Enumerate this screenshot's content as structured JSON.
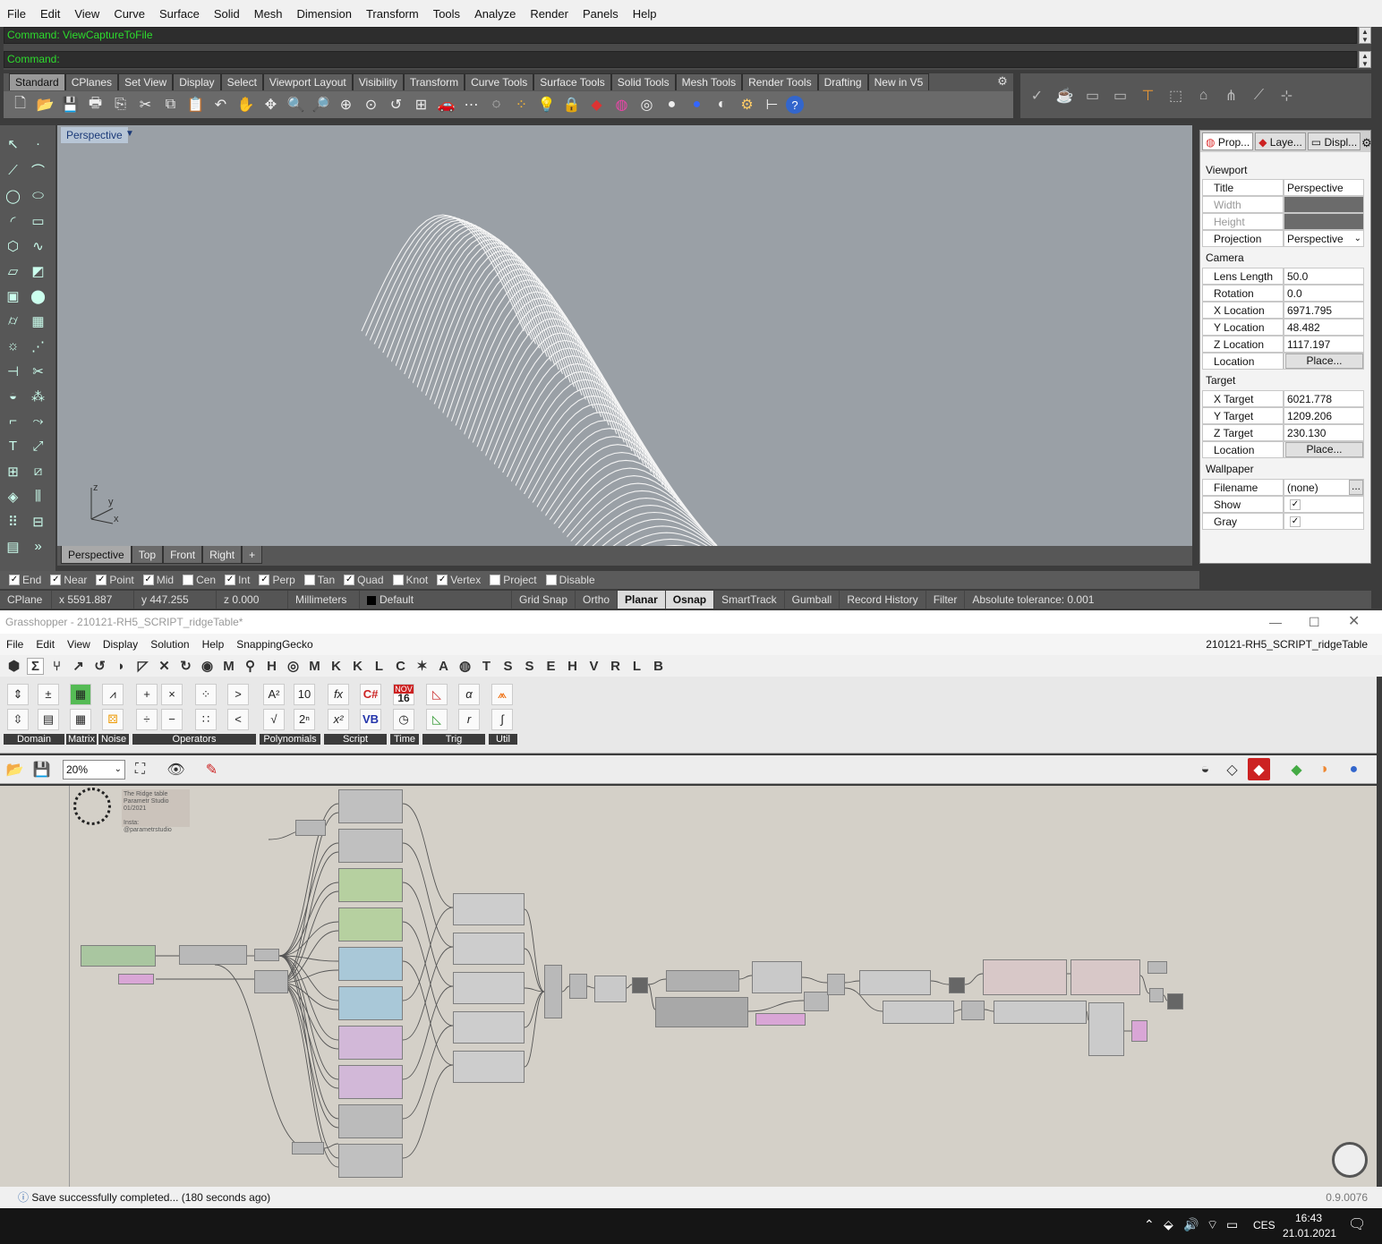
{
  "rhino": {
    "menu": [
      "File",
      "Edit",
      "View",
      "Curve",
      "Surface",
      "Solid",
      "Mesh",
      "Dimension",
      "Transform",
      "Tools",
      "Analyze",
      "Render",
      "Panels",
      "Help"
    ],
    "command_history": "Command: ViewCaptureToFile",
    "command_prompt": "Command:",
    "toolbar_tabs": [
      "Standard",
      "CPlanes",
      "Set View",
      "Display",
      "Select",
      "Viewport Layout",
      "Visibility",
      "Transform",
      "Curve Tools",
      "Surface Tools",
      "Solid Tools",
      "Mesh Tools",
      "Render Tools",
      "Drafting",
      "New in V5"
    ],
    "viewport_title": "Perspective",
    "viewport_tabs": [
      "Perspective",
      "Top",
      "Front",
      "Right"
    ],
    "axis_labels": {
      "z": "z",
      "y": "y",
      "x": "x"
    },
    "osnaps": [
      {
        "label": "End",
        "checked": true
      },
      {
        "label": "Near",
        "checked": true
      },
      {
        "label": "Point",
        "checked": true
      },
      {
        "label": "Mid",
        "checked": true
      },
      {
        "label": "Cen",
        "checked": false
      },
      {
        "label": "Int",
        "checked": true
      },
      {
        "label": "Perp",
        "checked": true
      },
      {
        "label": "Tan",
        "checked": false
      },
      {
        "label": "Quad",
        "checked": true
      },
      {
        "label": "Knot",
        "checked": false
      },
      {
        "label": "Vertex",
        "checked": true
      },
      {
        "label": "Project",
        "checked": false
      },
      {
        "label": "Disable",
        "checked": false
      }
    ],
    "status": {
      "cplane": "CPlane",
      "x": "x 5591.887",
      "y": "y 447.255",
      "z": "z 0.000",
      "units": "Millimeters",
      "layer": "Default",
      "grid_snap": "Grid Snap",
      "ortho": "Ortho",
      "planar": "Planar",
      "osnap": "Osnap",
      "smarttrack": "SmartTrack",
      "gumball": "Gumball",
      "record_history": "Record History",
      "filter": "Filter",
      "tolerance": "Absolute tolerance: 0.001"
    },
    "properties": {
      "tabs": [
        "Prop...",
        "Laye...",
        "Displ..."
      ],
      "viewport_header": "Viewport",
      "title_label": "Title",
      "title_value": "Perspective",
      "width_label": "Width",
      "height_label": "Height",
      "projection_label": "Projection",
      "projection_value": "Perspective",
      "camera_header": "Camera",
      "lens_label": "Lens Length",
      "lens_value": "50.0",
      "rotation_label": "Rotation",
      "rotation_value": "0.0",
      "xloc_label": "X Location",
      "xloc_value": "6971.795",
      "yloc_label": "Y Location",
      "yloc_value": "48.482",
      "zloc_label": "Z Location",
      "zloc_value": "1117.197",
      "location_label": "Location",
      "place_label": "Place...",
      "target_header": "Target",
      "xt_label": "X Target",
      "xt_value": "6021.778",
      "yt_label": "Y Target",
      "yt_value": "1209.206",
      "zt_label": "Z Target",
      "zt_value": "230.130",
      "wallpaper_header": "Wallpaper",
      "filename_label": "Filename",
      "filename_value": "(none)",
      "browse": "...",
      "show_label": "Show",
      "gray_label": "Gray"
    }
  },
  "grasshopper": {
    "window_title": "Grasshopper - 210121-RH5_SCRIPT_ridgeTable*",
    "menu": [
      "File",
      "Edit",
      "View",
      "Display",
      "Solution",
      "Help",
      "SnappingGecko"
    ],
    "doc_title": "210121-RH5_SCRIPT_ridgeTable",
    "categories": [
      "Σ",
      "M",
      "H",
      "M",
      "K",
      "K",
      "L",
      "C",
      "A",
      "T",
      "S",
      "S",
      "E",
      "H",
      "V",
      "R",
      "L",
      "B"
    ],
    "groups": [
      "Domain",
      "Matrix",
      "Noise",
      "Operators",
      "Polynomials",
      "Script",
      "Time",
      "Trig",
      "Util"
    ],
    "zoom": "20%",
    "calendar": {
      "month": "NOV",
      "day": "16"
    },
    "note": [
      "The Ridge table",
      "Parametr Studio",
      "01/2021",
      "",
      "Insta: @parametrstudio"
    ],
    "status_message": "Save successfully completed... (180 seconds ago)",
    "version": "0.9.0076"
  },
  "taskbar": {
    "lang": "CES",
    "time": "16:43",
    "date": "21.01.2021"
  }
}
